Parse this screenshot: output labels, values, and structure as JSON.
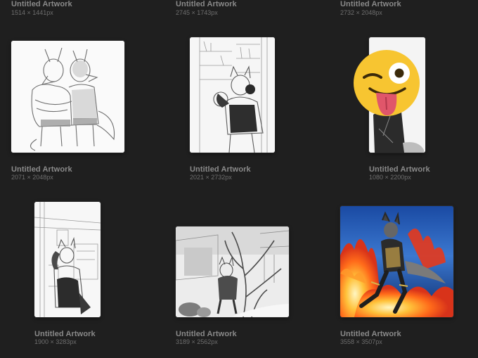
{
  "gallery": {
    "artworks": [
      {
        "title": "Untitled Artwork",
        "dimensions": "1514 × 1441px"
      },
      {
        "title": "Untitled Artwork",
        "dimensions": "2745 × 1743px"
      },
      {
        "title": "Untitled Artwork",
        "dimensions": "2732 × 2048px"
      },
      {
        "title": "Untitled Artwork",
        "dimensions": "2071 × 2048px"
      },
      {
        "title": "Untitled Artwork",
        "dimensions": "2021 × 2732px"
      },
      {
        "title": "Untitled Artwork",
        "dimensions": "1080 × 2200px"
      },
      {
        "title": "Untitled Artwork",
        "dimensions": "1900 × 3283px"
      },
      {
        "title": "Untitled Artwork",
        "dimensions": "3189 × 2562px"
      },
      {
        "title": "Untitled Artwork",
        "dimensions": "3558 × 3507px"
      }
    ]
  },
  "overlay": {
    "icon": "winking-tongue-emoji-icon"
  },
  "colors": {
    "background": "#1f1f1f",
    "title": "#8a8a8a",
    "dims": "#6f6f6f",
    "emoji": "#f7c531"
  }
}
